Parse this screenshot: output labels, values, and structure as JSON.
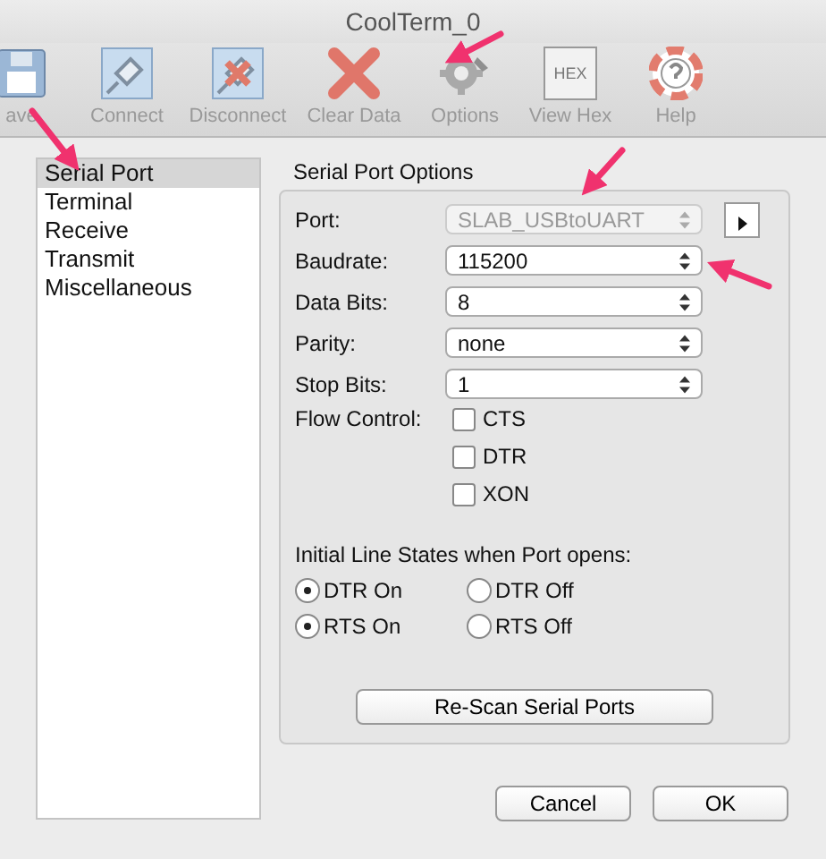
{
  "window": {
    "title": "CoolTerm_0"
  },
  "toolbar": [
    {
      "kind": "save",
      "label": "ave"
    },
    {
      "kind": "connect",
      "label": "Connect"
    },
    {
      "kind": "disconnect",
      "label": "Disconnect"
    },
    {
      "kind": "clear",
      "label": "Clear Data"
    },
    {
      "kind": "options",
      "label": "Options"
    },
    {
      "kind": "hex",
      "label": "View Hex",
      "icon_text": "HEX"
    },
    {
      "kind": "help",
      "label": "Help"
    }
  ],
  "sidebar": {
    "items": [
      {
        "label": "Serial Port",
        "selected": true
      },
      {
        "label": "Terminal",
        "selected": false
      },
      {
        "label": "Receive",
        "selected": false
      },
      {
        "label": "Transmit",
        "selected": false
      },
      {
        "label": "Miscellaneous",
        "selected": false
      }
    ]
  },
  "options": {
    "title": "Serial Port Options",
    "fields": [
      {
        "label": "Port:",
        "value": "SLAB_USBtoUART",
        "disabled": true
      },
      {
        "label": "Baudrate:",
        "value": "115200",
        "disabled": false
      },
      {
        "label": "Data Bits:",
        "value": "8",
        "disabled": false
      },
      {
        "label": "Parity:",
        "value": "none",
        "disabled": false
      },
      {
        "label": "Stop Bits:",
        "value": "1",
        "disabled": false
      }
    ],
    "flow_control": {
      "label": "Flow Control:",
      "options": [
        {
          "label": "CTS",
          "checked": false
        },
        {
          "label": "DTR",
          "checked": false
        },
        {
          "label": "XON",
          "checked": false
        }
      ]
    },
    "line_states": {
      "title": "Initial Line States when Port opens:",
      "groups": [
        [
          {
            "label": "DTR On",
            "selected": true
          },
          {
            "label": "DTR Off",
            "selected": false
          }
        ],
        [
          {
            "label": "RTS On",
            "selected": true
          },
          {
            "label": "RTS Off",
            "selected": false
          }
        ]
      ]
    },
    "rescan_button": "Re-Scan Serial Ports"
  },
  "buttons": [
    "Cancel",
    "OK"
  ]
}
